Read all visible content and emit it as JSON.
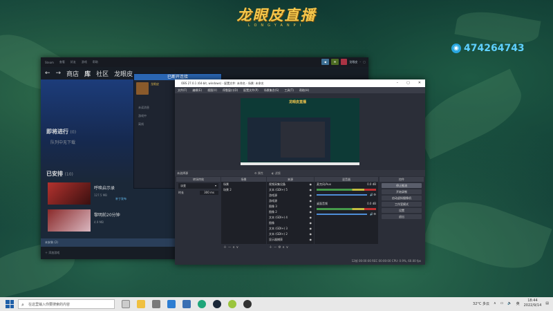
{
  "brand": {
    "title": "龙眼皮直播",
    "subtitle": "LONGYANPI"
  },
  "qq_number": "474264743",
  "steam": {
    "topmenu": [
      "Steam",
      "查看",
      "好友",
      "游戏",
      "帮助"
    ],
    "user": "龙眼皮",
    "nav": [
      "商店",
      "库",
      "社区",
      "龙眼皮"
    ],
    "upcoming_title": "即将进行",
    "upcoming_count": "(0)",
    "upcoming_empty": "队列中无下载",
    "scheduled_title": "已安排",
    "scheduled_count": "(10)",
    "games": [
      {
        "name": "呼唤启示录",
        "size": "127.5 MB",
        "tag": "补丁发布"
      },
      {
        "name": "黎明前20分钟",
        "size": "4.9 MB"
      }
    ],
    "download_bar": "未安装 (2)",
    "add_game": "添加游戏",
    "friends_header": "已断开连接",
    "friends_user": "龙眼皮",
    "friends_rows": [
      "未读消息",
      "游戏中",
      "离线"
    ]
  },
  "obs": {
    "title": "OBS 27.0.1 (64-bit, windows) - 配置文件: 未命名 - 场景: 未命名",
    "menu": [
      "文件(F)",
      "编辑(E)",
      "视图(V)",
      "停靠窗口(D)",
      "配置文件(P)",
      "场景集合(S)",
      "工具(T)",
      "帮助(H)"
    ],
    "preview_title": "龙眼皮直播",
    "no_source": "未选择源",
    "props_btn": "属性",
    "filter_btn": "滤镜",
    "docks": {
      "transition": "转场特效",
      "scenes": "场景",
      "sources": "来源",
      "mixer": "混音器",
      "controls": "控件"
    },
    "transition_value": "淡变",
    "transition_duration_label": "时长",
    "transition_duration": "300 ms",
    "scenes": [
      "场景",
      "场景 2"
    ],
    "sources": [
      "视频采集设备",
      "文本 (GDI+) 5",
      "游戏源",
      "游戏源",
      "图像 3",
      "图像 2",
      "文本 (GDI+) 4",
      "图像",
      "文本 (GDI+) 3",
      "文本 (GDI+) 2",
      "显示器捕获"
    ],
    "mixer": [
      {
        "name": "麦克风/Aux",
        "db": "0.0 dB"
      },
      {
        "name": "桌面音频",
        "db": "0.0 dB"
      }
    ],
    "controls": [
      "停止推流",
      "开始录制",
      "启动虚拟摄像机",
      "工作室模式",
      "设置",
      "退出"
    ],
    "status": "12帧  00:00:00   REC  00:00:00   CPU: 0.9%, 60.00 fps"
  },
  "taskbar": {
    "search_placeholder": "在这里输入你要搜索的内容",
    "weather": "32°C  多云",
    "ime": "英",
    "time": "18:44",
    "date": "2022/9/14"
  }
}
